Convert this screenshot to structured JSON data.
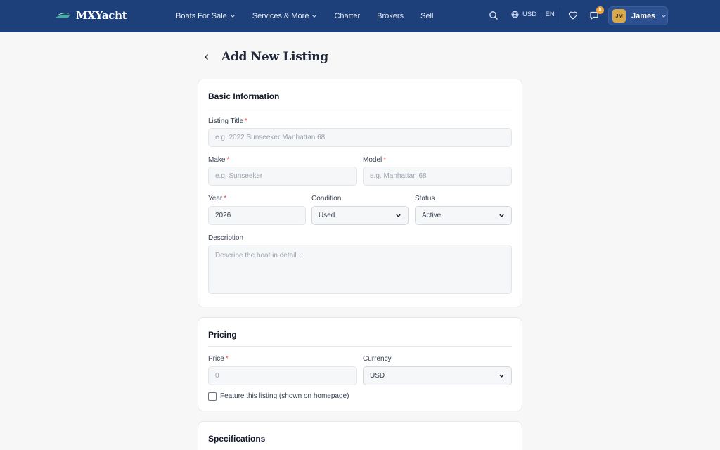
{
  "brand": {
    "name": "MXYacht"
  },
  "nav": {
    "items": [
      {
        "label": "Boats For Sale",
        "has_dropdown": true
      },
      {
        "label": "Services & More",
        "has_dropdown": true
      },
      {
        "label": "Charter",
        "has_dropdown": false
      },
      {
        "label": "Brokers",
        "has_dropdown": false
      },
      {
        "label": "Sell",
        "has_dropdown": false
      }
    ]
  },
  "header_tools": {
    "currency": "USD",
    "language": "EN",
    "separator": "|",
    "messages_badge": "8",
    "user_initials": "JM",
    "user_name": "James"
  },
  "page": {
    "title": "Add New Listing"
  },
  "basic_info": {
    "title": "Basic Information",
    "listing_title_label": "Listing Title",
    "listing_title_placeholder": "e.g. 2022 Sunseeker Manhattan 68",
    "make_label": "Make",
    "make_placeholder": "e.g. Sunseeker",
    "model_label": "Model",
    "model_placeholder": "e.g. Manhattan 68",
    "year_label": "Year",
    "year_value": "2026",
    "condition_label": "Condition",
    "condition_value": "Used",
    "status_label": "Status",
    "status_value": "Active",
    "description_label": "Description",
    "description_placeholder": "Describe the boat in detail..."
  },
  "pricing": {
    "title": "Pricing",
    "price_label": "Price",
    "price_placeholder": "0",
    "currency_label": "Currency",
    "currency_value": "USD",
    "feature_label": "Feature this listing (shown on homepage)"
  },
  "specifications": {
    "title": "Specifications"
  },
  "required_mark": "*",
  "colors": {
    "header": "#1d3f7a",
    "accent": "#f2a33a",
    "required": "#ef4444"
  }
}
